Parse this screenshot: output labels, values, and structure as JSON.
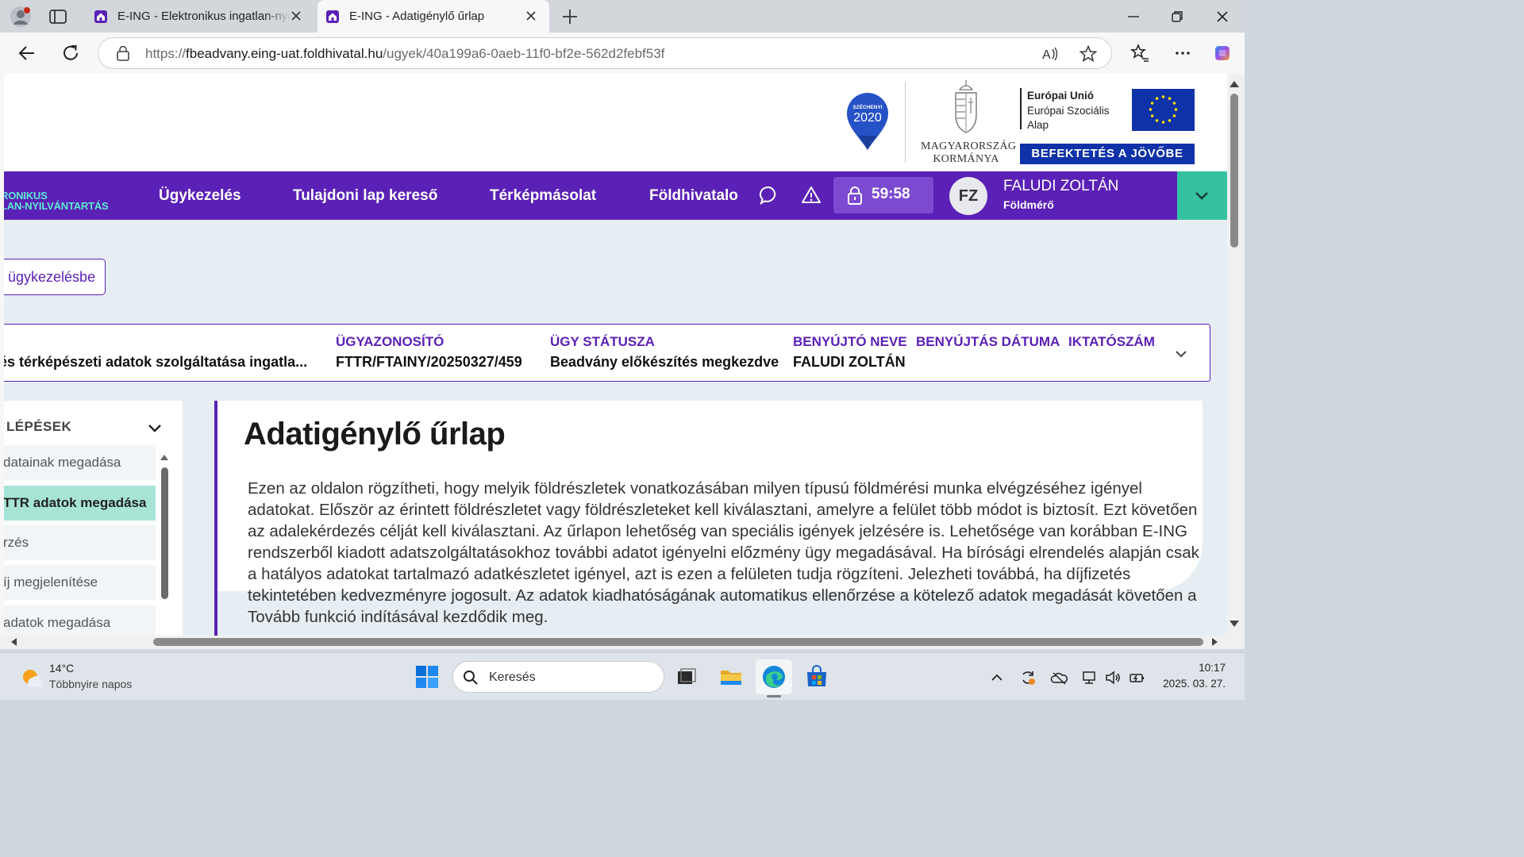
{
  "browser": {
    "tabs": [
      {
        "title": "E-ING - Elektronikus ingatlan-nyilvántartás",
        "active": false
      },
      {
        "title": "E-ING - Adatigénylő űrlap",
        "active": true
      }
    ],
    "url_prefix": "https://",
    "url_host": "fbeadvany.eing-uat.foldhivatal.hu",
    "url_path": "/ugyek/40a199a6-0aeb-11f0-bf2e-562d2febf53f"
  },
  "header": {
    "szechenyi_top": "SZÉCHENYI",
    "szechenyi_year": "2020",
    "gov_line1": "MAGYARORSZÁG",
    "gov_line2": "KORMÁNYA",
    "eu_line1": "Európai Unió",
    "eu_line2": "Európai Szociális",
    "eu_line3": "Alap",
    "invest": "BEFEKTETÉS A JÖVŐBE"
  },
  "menu": {
    "brand_line1": "RONIKUS",
    "brand_line2": "LAN-NYILVÁNTARTÁS",
    "items": [
      "Ügykezelés",
      "Tulajdoni lap kereső",
      "Térképmásolat",
      "Földhivatalo"
    ],
    "timer": "59:58",
    "user_initials": "FZ",
    "user_name": "FALUDI ZOLTÁN",
    "user_role": "Földmérő"
  },
  "back_button": "ügykezelésbe",
  "case": {
    "name_value": "és térképészeti adatok szolgáltatása ingatla...",
    "id_label": "ÜGYAZONOSÍTÓ",
    "id_value": "FTTR/FTAINY/20250327/459",
    "status_label": "ÜGY STÁTUSZA",
    "status_value": "Beadvány előkészítés megkezdve",
    "submitter_label": "BENYÚJTÓ NEVE",
    "submitter_value": "FALUDI ZOLTÁN",
    "date_label": "BENYÚJTÁS DÁTUMA",
    "filing_label": "IKTATÓSZÁM"
  },
  "steps": {
    "heading": "LÉPÉSEK",
    "items": [
      {
        "label": "datainak megadása",
        "active": false
      },
      {
        "label": "TTR adatok megadása",
        "active": true
      },
      {
        "label": "rzés",
        "active": false
      },
      {
        "label": "íj megjelenítése",
        "active": false
      },
      {
        "label": "adatok megadása",
        "active": false
      }
    ]
  },
  "main": {
    "title": "Adatigénylő űrlap",
    "intro": "Ezen az oldalon rögzítheti, hogy melyik földrészletek vonatkozásában milyen típusú földmérési munka elvégzéséhez igényel adatokat. Először az érintett földrészletet vagy földrészleteket kell kiválasztani, amelyre a felület több módot is biztosít. Ezt követően az adalekérdezés célját kell kiválasztani. Az űrlapon lehetőség van speciális igények jelzésére is. Lehetősége van korábban E-ING rendszerből kiadott adatszolgáltatásokhoz további adatot igényelni előzmény ügy megadásával. Ha bírósági elrendelés alapján csak a hatályos adatokat tartalmazó adatkészletet igényel, azt is ezen a felületen tudja rögzíteni. Jelezheti továbbá, ha díjfizetés tekintetében kedvezményre jogosult. Az adatok kiadhatóságának automatikus ellenőrzése a kötelező adatok megadását követően a Tovább funkció indításával kezdődik meg."
  },
  "taskbar": {
    "weather_temp": "14°C",
    "weather_desc": "Többnyire napos",
    "search_placeholder": "Keresés",
    "time": "10:17",
    "date": "2025. 03. 27."
  },
  "colors": {
    "brand_purple": "#5b21b6",
    "accent_teal": "#34c2a0",
    "active_step": "#a7e4d6",
    "eu_blue": "#0f32a8"
  }
}
